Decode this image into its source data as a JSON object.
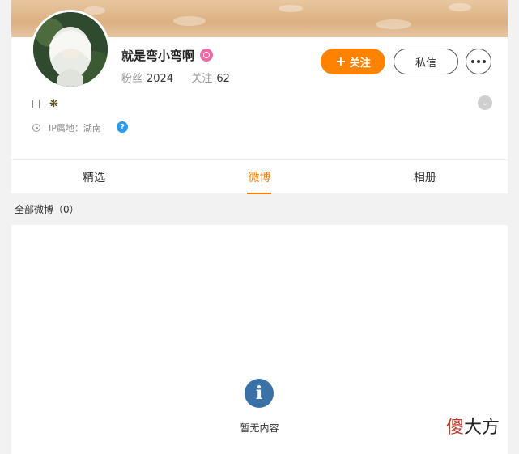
{
  "profile": {
    "name": "就是弯小弯啊",
    "fans_label": "粉丝",
    "fans_value": "2024",
    "follow_label": "关注",
    "follow_value": "62",
    "flower": "❋",
    "ip_location": "IP属地：湖南"
  },
  "actions": {
    "follow_label": "关注",
    "follow_plus": "+",
    "message_label": "私信"
  },
  "tabs": [
    {
      "label": "精选"
    },
    {
      "label": "微博",
      "active": true
    },
    {
      "label": "相册"
    }
  ],
  "feed": {
    "count_label": "全部微博（0）",
    "empty_text": "暂无内容",
    "empty_icon": "i"
  },
  "watermark": {
    "first": "傻",
    "rest": "大方"
  },
  "colors": {
    "accent": "#ff8200",
    "help": "#2a9bf0",
    "empty_icon": "#3a72a8",
    "badge": "#f06aa7"
  },
  "icons": [
    "doc-icon",
    "location-icon",
    "help-icon",
    "expand-chevron-icon",
    "more-icon",
    "info-icon",
    "verified-badge-icon"
  ]
}
